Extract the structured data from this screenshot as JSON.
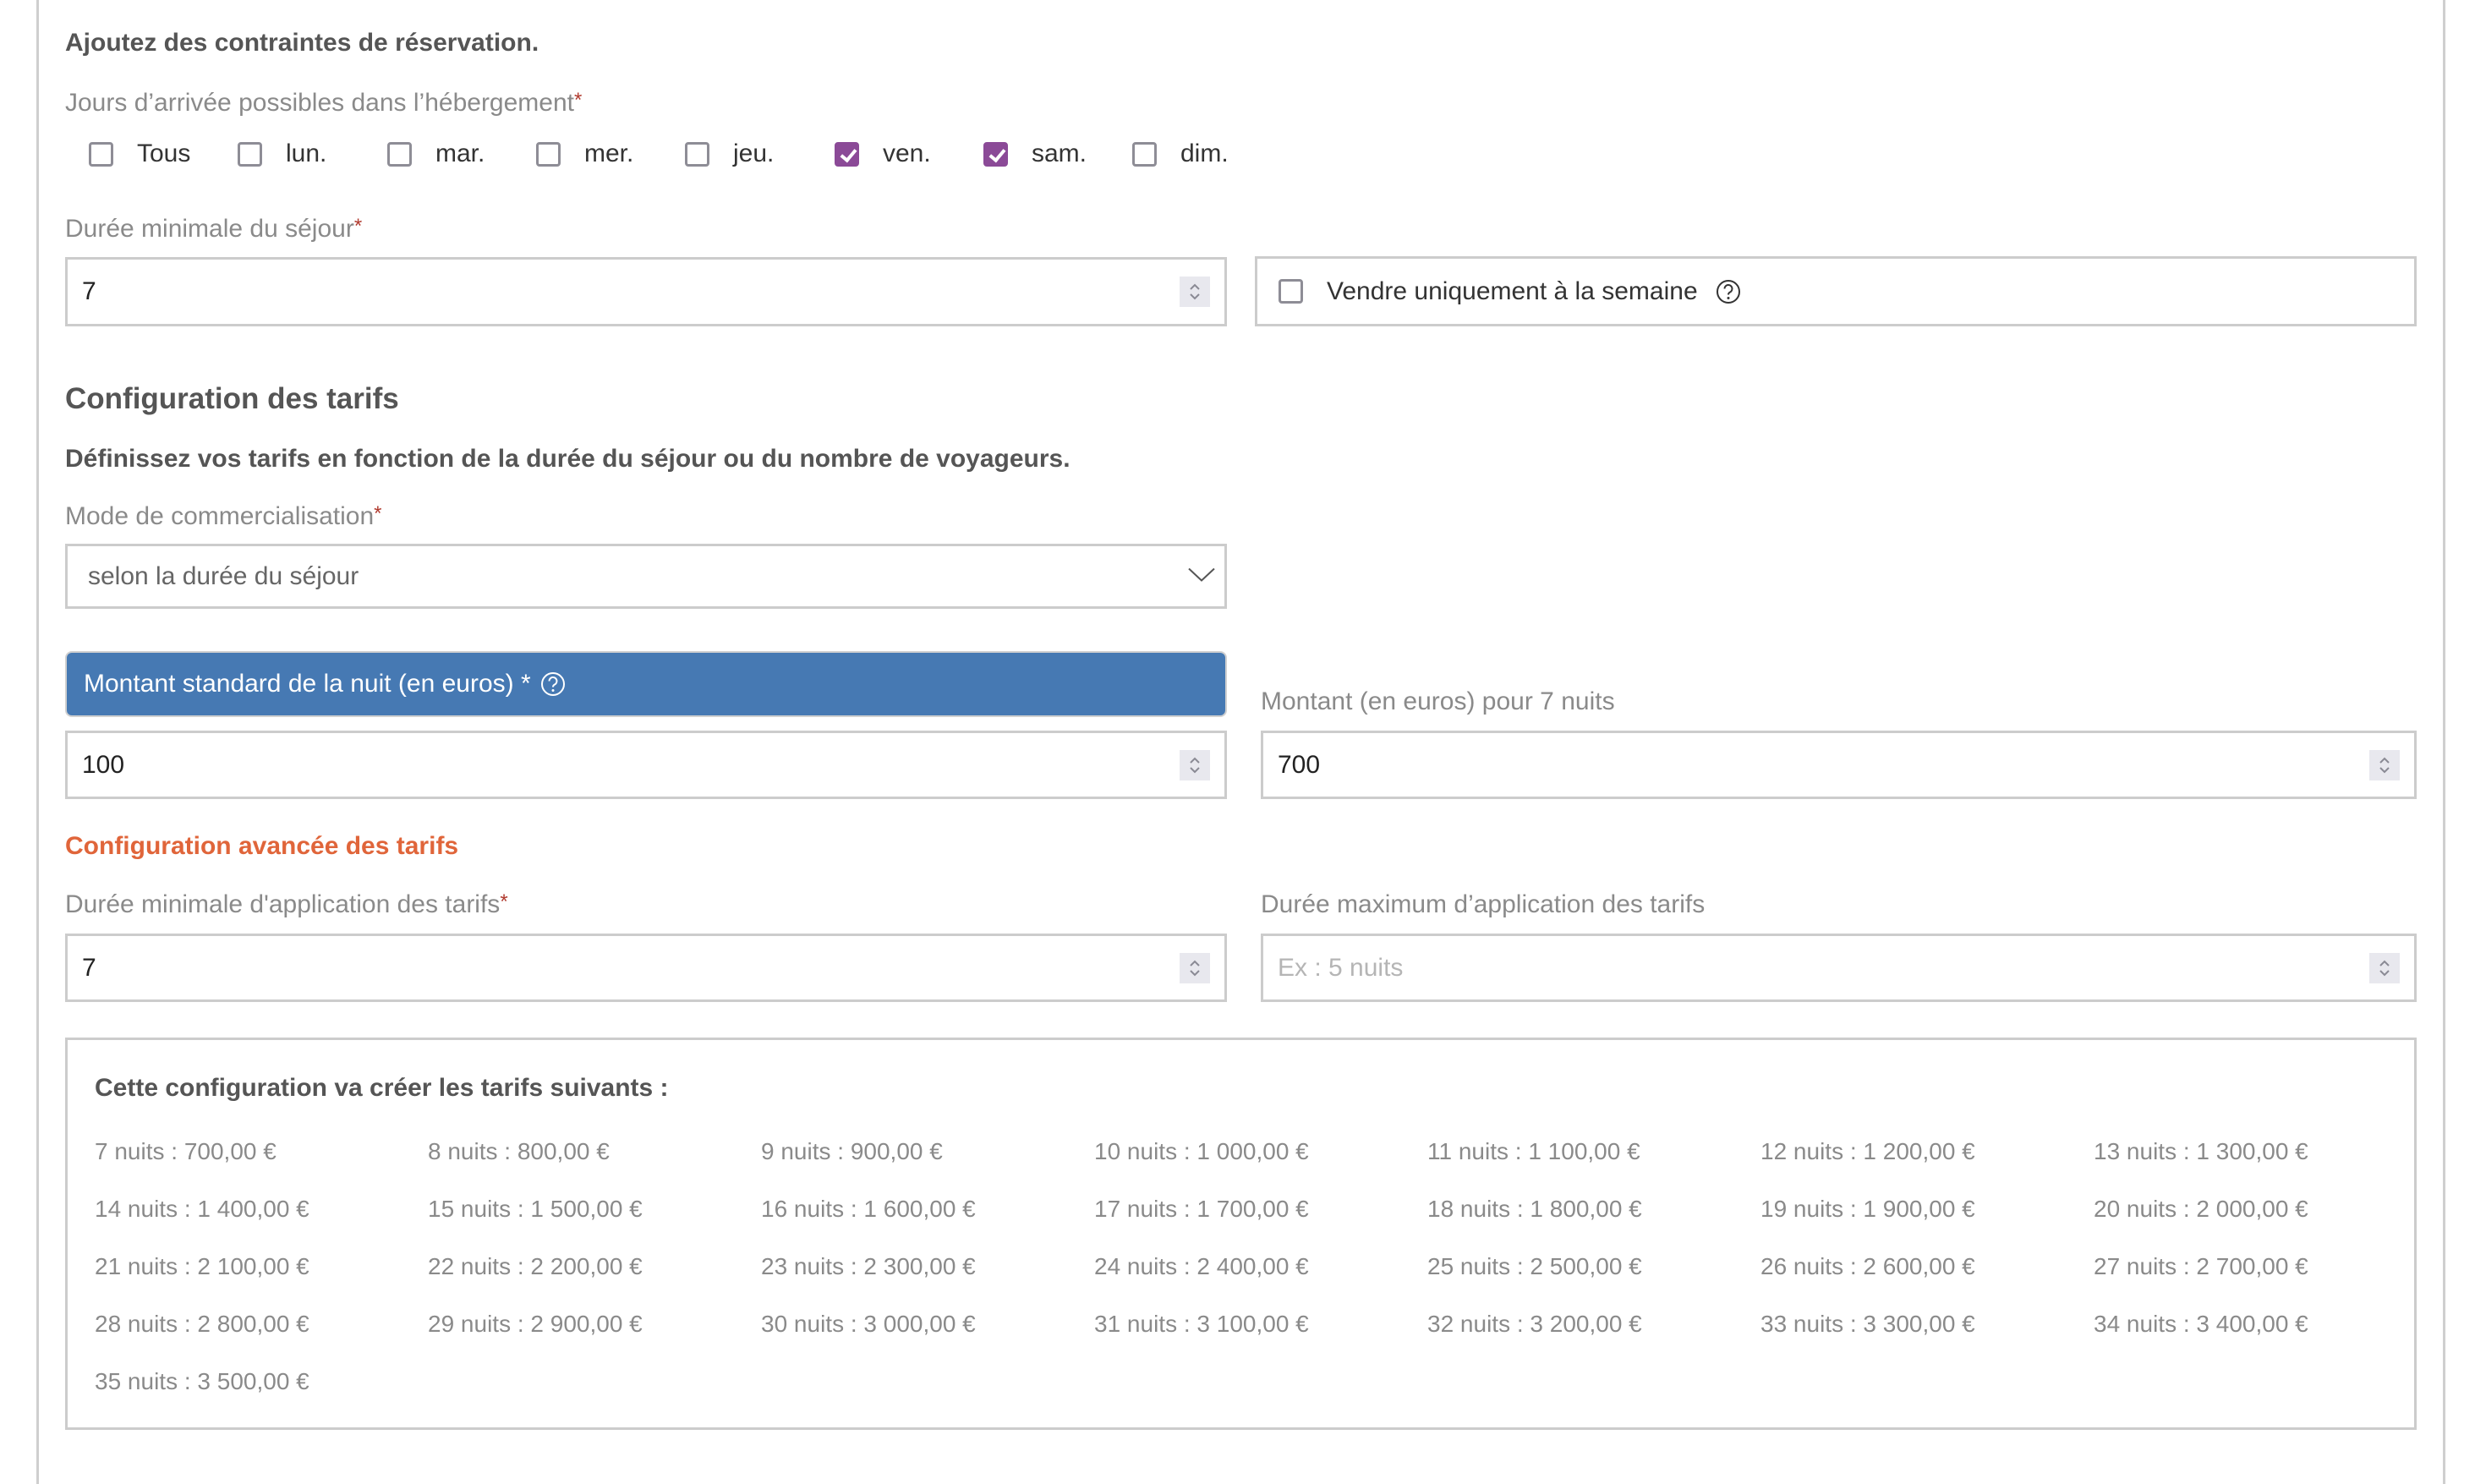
{
  "constraints": {
    "title": "Ajoutez des contraintes de réservation.",
    "arrival_days_label": "Jours d’arrivée possibles dans l’hébergement",
    "required_mark": "*",
    "days": [
      {
        "label": "Tous",
        "checked": false
      },
      {
        "label": "lun.",
        "checked": false
      },
      {
        "label": "mar.",
        "checked": false
      },
      {
        "label": "mer.",
        "checked": false
      },
      {
        "label": "jeu.",
        "checked": false
      },
      {
        "label": "ven.",
        "checked": true
      },
      {
        "label": "sam.",
        "checked": true
      },
      {
        "label": "dim.",
        "checked": false
      }
    ],
    "min_stay_label": "Durée minimale du séjour",
    "min_stay_value": "7",
    "weekly_only_label": "Vendre uniquement à la semaine",
    "weekly_only_checked": false
  },
  "pricing": {
    "title": "Configuration des tarifs",
    "subtitle": "Définissez vos tarifs en fonction de la durée du séjour ou du nombre de voyageurs.",
    "mode_label": "Mode de commercialisation",
    "mode_value": "selon la durée du séjour",
    "nightly_label": "Montant standard de la nuit (en euros) *",
    "nightly_value": "100",
    "total_label": "Montant (en euros) pour 7 nuits",
    "total_value": "700"
  },
  "advanced": {
    "title": "Configuration avancée des tarifs",
    "min_duration_label": "Durée minimale d'application des tarifs",
    "min_duration_value": "7",
    "max_duration_label": "Durée maximum d’application des tarifs",
    "max_duration_placeholder": "Ex : 5 nuits"
  },
  "tariffs": {
    "heading": "Cette configuration va créer les tarifs suivants :",
    "items": [
      "7 nuits : 700,00 €",
      "8 nuits : 800,00 €",
      "9 nuits : 900,00 €",
      "10 nuits : 1 000,00 €",
      "11 nuits : 1 100,00 €",
      "12 nuits : 1 200,00 €",
      "13 nuits : 1 300,00 €",
      "14 nuits : 1 400,00 €",
      "15 nuits : 1 500,00 €",
      "16 nuits : 1 600,00 €",
      "17 nuits : 1 700,00 €",
      "18 nuits : 1 800,00 €",
      "19 nuits : 1 900,00 €",
      "20 nuits : 2 000,00 €",
      "21 nuits : 2 100,00 €",
      "22 nuits : 2 200,00 €",
      "23 nuits : 2 300,00 €",
      "24 nuits : 2 400,00 €",
      "25 nuits : 2 500,00 €",
      "26 nuits : 2 600,00 €",
      "27 nuits : 2 700,00 €",
      "28 nuits : 2 800,00 €",
      "29 nuits : 2 900,00 €",
      "30 nuits : 3 000,00 €",
      "31 nuits : 3 100,00 €",
      "32 nuits : 3 200,00 €",
      "33 nuits : 3 300,00 €",
      "34 nuits : 3 400,00 €",
      "35 nuits : 3 500,00 €"
    ]
  },
  "colors": {
    "checkbox_checked": "#8b4a97",
    "header_blue": "#4679b3",
    "advanced_orange": "#e0653a",
    "required_red": "#b03a2e"
  },
  "icons": {
    "help": "question-circle-icon",
    "stepper": "chevron-up-down-icon",
    "select": "chevron-down-icon",
    "check": "check-icon"
  }
}
